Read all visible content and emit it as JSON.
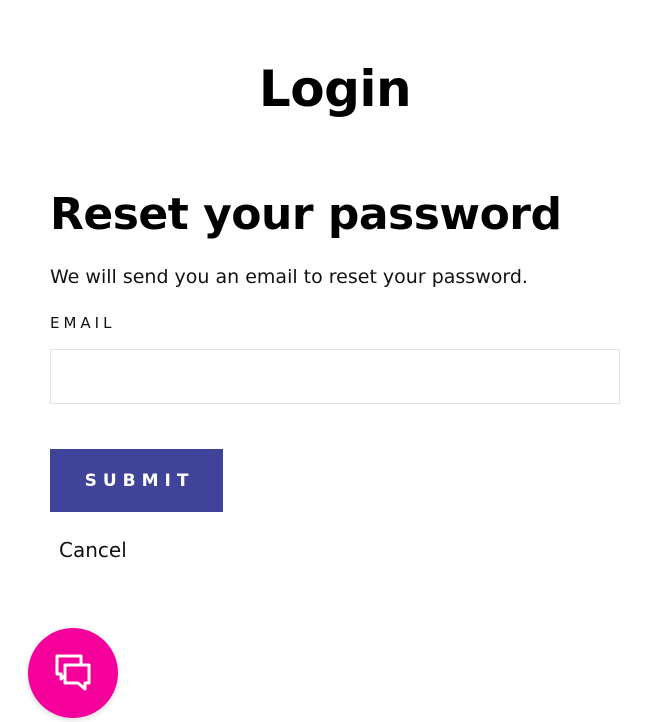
{
  "header": {
    "title": "Login"
  },
  "reset_form": {
    "heading": "Reset your password",
    "description": "We will send you an email to reset your password.",
    "email_label": "EMAIL",
    "email_value": "",
    "email_placeholder": "",
    "submit_label": "SUBMIT",
    "cancel_label": "Cancel"
  },
  "chat_widget": {
    "icon": "chat-bubbles-icon",
    "color": "#f5009b"
  },
  "colors": {
    "accent": "#3f4399",
    "chat": "#f5009b",
    "input_border": "#e3e3e3"
  }
}
